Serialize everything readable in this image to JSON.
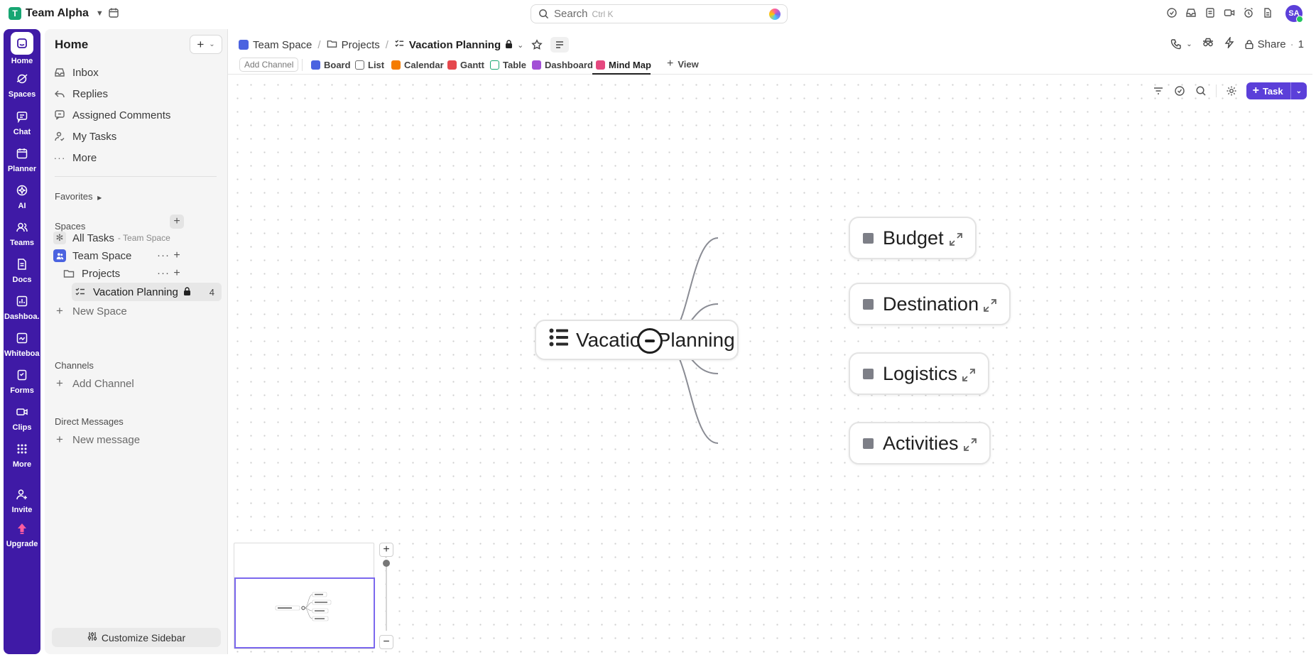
{
  "workspace": {
    "initial": "T",
    "name": "Team Alpha"
  },
  "search": {
    "label": "Search",
    "shortcut": "Ctrl K"
  },
  "user": {
    "initials": "SA"
  },
  "rail": [
    {
      "label": "Home",
      "icon": "home-icon"
    },
    {
      "label": "Spaces",
      "icon": "spaces-icon"
    },
    {
      "label": "Chat",
      "icon": "chat-icon"
    },
    {
      "label": "Planner",
      "icon": "planner-icon"
    },
    {
      "label": "AI",
      "icon": "ai-icon"
    },
    {
      "label": "Teams",
      "icon": "teams-icon"
    },
    {
      "label": "Docs",
      "icon": "docs-icon"
    },
    {
      "label": "Dashboa..",
      "icon": "dashboard-icon"
    },
    {
      "label": "Whiteboa..",
      "icon": "whiteboard-icon"
    },
    {
      "label": "Forms",
      "icon": "forms-icon"
    },
    {
      "label": "Clips",
      "icon": "clips-icon"
    },
    {
      "label": "More",
      "icon": "grid-icon"
    },
    {
      "label": "Invite",
      "icon": "invite-icon"
    },
    {
      "label": "Upgrade",
      "icon": "upgrade-icon"
    }
  ],
  "sidebar": {
    "title": "Home",
    "nav": [
      {
        "label": "Inbox",
        "icon": "inbox-icon"
      },
      {
        "label": "Replies",
        "icon": "reply-icon"
      },
      {
        "label": "Assigned Comments",
        "icon": "comment-icon"
      },
      {
        "label": "My Tasks",
        "icon": "my-tasks-icon"
      },
      {
        "label": "More",
        "icon": "more-icon"
      }
    ],
    "favorites": "Favorites",
    "spaces_heading": "Spaces",
    "all_tasks": {
      "label": "All Tasks",
      "sub": "- Team Space"
    },
    "team_space": {
      "initial": "👥",
      "label": "Team Space"
    },
    "projects": "Projects",
    "vacation": {
      "label": "Vacation Planning",
      "count": "4"
    },
    "new_space": "New Space",
    "channels_heading": "Channels",
    "add_channel": "Add Channel",
    "dm_heading": "Direct Messages",
    "new_message": "New message",
    "customize": "Customize Sidebar"
  },
  "breadcrumb": {
    "space": "Team Space",
    "folder": "Projects",
    "list": "Vacation Planning"
  },
  "header_right": {
    "share": "Share",
    "share_count": "1"
  },
  "views": {
    "add_channel": "Add Channel",
    "tabs": [
      {
        "label": "Board",
        "color": "#4b63e0"
      },
      {
        "label": "List",
        "color": "#6b6b6b"
      },
      {
        "label": "Calendar",
        "color": "#f57c00"
      },
      {
        "label": "Gantt",
        "color": "#e5484d"
      },
      {
        "label": "Table",
        "color": "#17a672"
      },
      {
        "label": "Dashboard",
        "color": "#a24fd6"
      },
      {
        "label": "Mind Map",
        "color": "#e5487f"
      }
    ],
    "add_view": "View"
  },
  "toolbar": {
    "task": "Task"
  },
  "mindmap": {
    "root": "Vacation Planning",
    "children": [
      "Budget",
      "Destination",
      "Logistics",
      "Activities"
    ]
  }
}
